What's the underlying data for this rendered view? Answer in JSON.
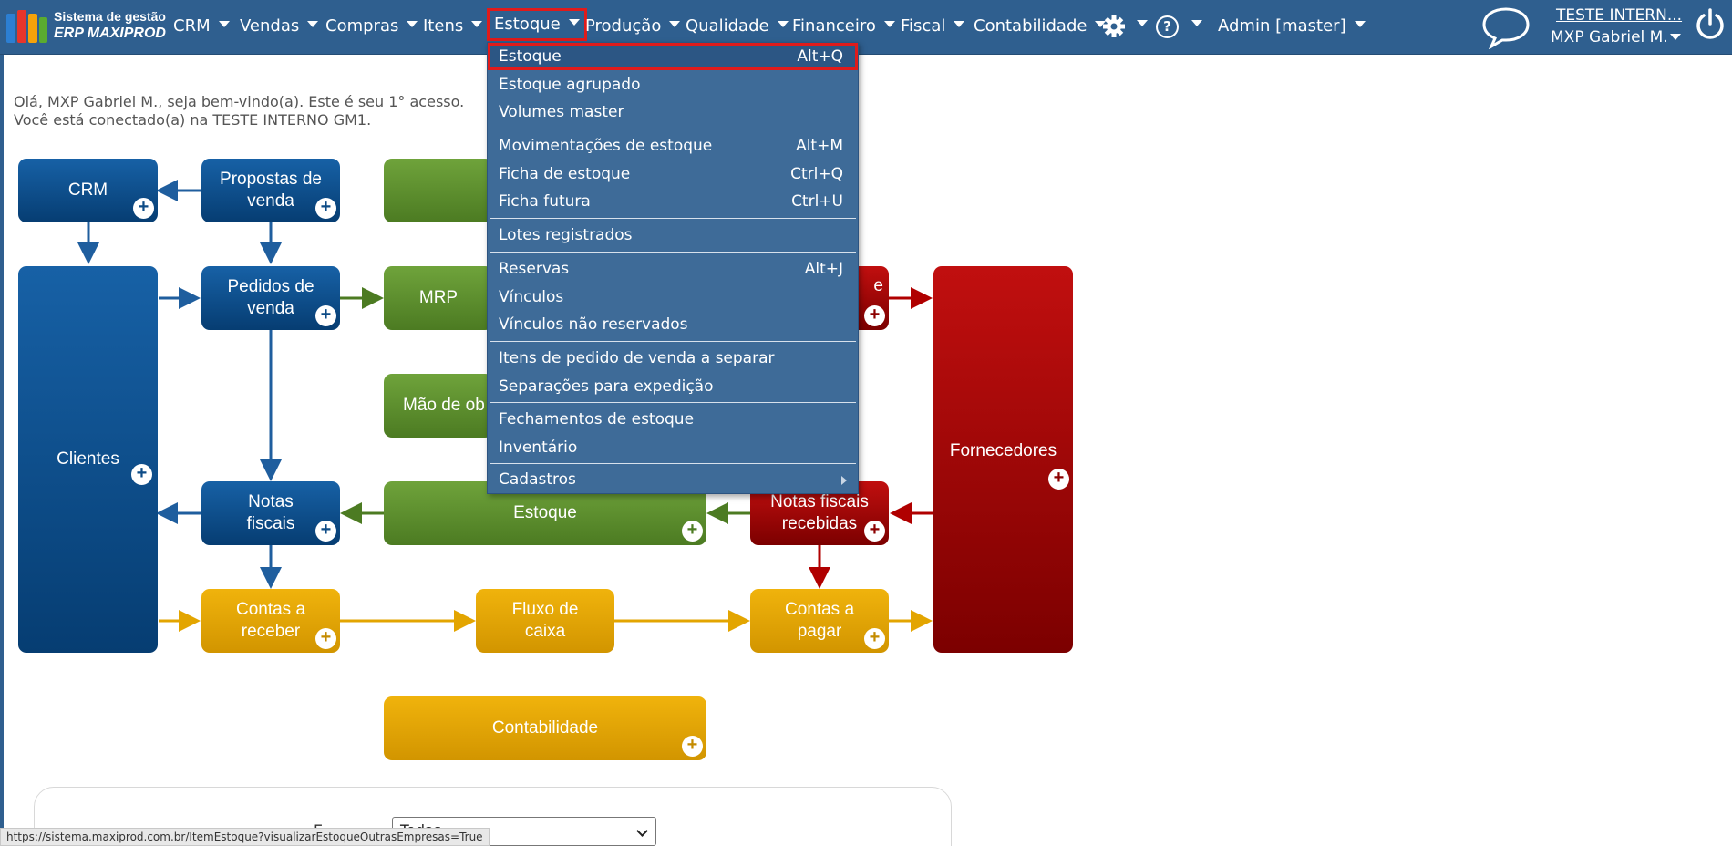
{
  "logo": {
    "title": "Sistema de gestão",
    "subtitle": "ERP MAXIPROD"
  },
  "nav": {
    "items": [
      "CRM",
      "Vendas",
      "Compras",
      "Itens",
      "Estoque",
      "Produção",
      "Qualidade",
      "Financeiro",
      "Fiscal",
      "Contabilidade"
    ],
    "admin": "Admin [master]",
    "company": "TESTE INTERN...",
    "user": "MXP Gabriel M."
  },
  "icons": {
    "settings": "gear-icon",
    "help": "help-icon",
    "chat": "chat-bubble-icon",
    "logout": "power-icon"
  },
  "welcome": {
    "greeting": "Olá, MXP Gabriel M., seja bem-vindo(a).",
    "access_link": "Este é seu 1° acesso.",
    "connected": "Você está conectado(a) na TESTE INTERNO GM1."
  },
  "flow": {
    "crm": "CRM",
    "propostas": "Propostas de venda",
    "pedidos": "Pedidos de venda",
    "clientes": "Clientes",
    "mrp": "MRP",
    "mao_obra": "Mão de ob",
    "notas_fiscais": "Notas fiscais",
    "estoque": "Estoque",
    "notas_recebidas": "Notas fiscais recebidas",
    "fornecedores": "Fornecedores",
    "contas_receber": "Contas a receber",
    "fluxo_caixa": "Fluxo de caixa",
    "contas_pagar": "Contas a pagar",
    "contabilidade": "Contabilidade",
    "partial_label": "e"
  },
  "estoque_menu": {
    "items": [
      {
        "label": "Estoque",
        "shortcut": "Alt+Q"
      },
      {
        "label": "Estoque agrupado",
        "shortcut": ""
      },
      {
        "label": "Volumes master",
        "shortcut": ""
      },
      {
        "label": "Movimentações de estoque",
        "shortcut": "Alt+M"
      },
      {
        "label": "Ficha de estoque",
        "shortcut": "Ctrl+Q"
      },
      {
        "label": "Ficha futura",
        "shortcut": "Ctrl+U"
      },
      {
        "label": "Lotes registrados",
        "shortcut": ""
      },
      {
        "label": "Reservas",
        "shortcut": "Alt+J"
      },
      {
        "label": "Vínculos",
        "shortcut": ""
      },
      {
        "label": "Vínculos não reservados",
        "shortcut": ""
      },
      {
        "label": "Itens de pedido de venda a separar",
        "shortcut": ""
      },
      {
        "label": "Separações para expedição",
        "shortcut": ""
      },
      {
        "label": "Fechamentos de estoque",
        "shortcut": ""
      },
      {
        "label": "Inventário",
        "shortcut": ""
      },
      {
        "label": "Cadastros",
        "shortcut": ""
      }
    ]
  },
  "bottom": {
    "select_value": "Todas",
    "select_label_partial": "E"
  },
  "status_url": "https://sistema.maxiprod.com.br/ItemEstoque?visualizarEstoqueOutrasEmpresas=True",
  "colors": {
    "topbar": "#2f5f8f",
    "menu": "#3e6b98",
    "highlight": "#e01b1b",
    "blue": "#0d4b86",
    "green": "#5a8a2c",
    "red": "#a00000",
    "gold": "#e3a500"
  }
}
